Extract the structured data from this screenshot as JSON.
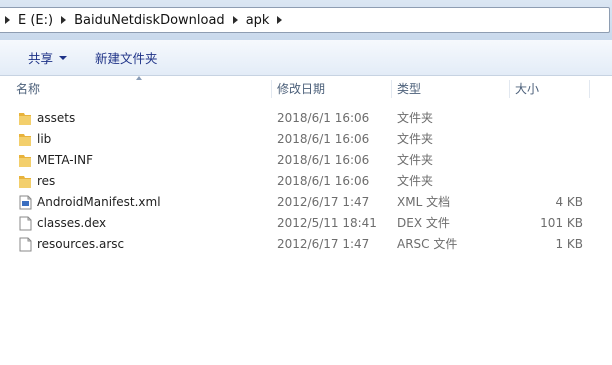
{
  "address": {
    "crumbs": [
      "E (E:)",
      "BaiduNetdiskDownload",
      "apk"
    ]
  },
  "toolbar": {
    "share_label": "共享",
    "new_folder_label": "新建文件夹"
  },
  "columns": {
    "name": "名称",
    "date": "修改日期",
    "type": "类型",
    "size": "大小"
  },
  "files": [
    {
      "name": "assets",
      "date": "2018/6/1 16:06",
      "type": "文件夹",
      "size": "",
      "icon": "folder-icon"
    },
    {
      "name": "lib",
      "date": "2018/6/1 16:06",
      "type": "文件夹",
      "size": "",
      "icon": "folder-icon"
    },
    {
      "name": "META-INF",
      "date": "2018/6/1 16:06",
      "type": "文件夹",
      "size": "",
      "icon": "folder-icon"
    },
    {
      "name": "res",
      "date": "2018/6/1 16:06",
      "type": "文件夹",
      "size": "",
      "icon": "folder-icon"
    },
    {
      "name": "AndroidManifest.xml",
      "date": "2012/6/17 1:47",
      "type": "XML 文档",
      "size": "4 KB",
      "icon": "xml-file-icon"
    },
    {
      "name": "classes.dex",
      "date": "2012/5/11 18:41",
      "type": "DEX 文件",
      "size": "101 KB",
      "icon": "file-icon"
    },
    {
      "name": "resources.arsc",
      "date": "2012/6/17 1:47",
      "type": "ARSC 文件",
      "size": "1 KB",
      "icon": "file-icon"
    }
  ],
  "colors": {
    "toolbar_text": "#1e3287",
    "header_text": "#4c607a",
    "folder": "#e8b33c"
  }
}
